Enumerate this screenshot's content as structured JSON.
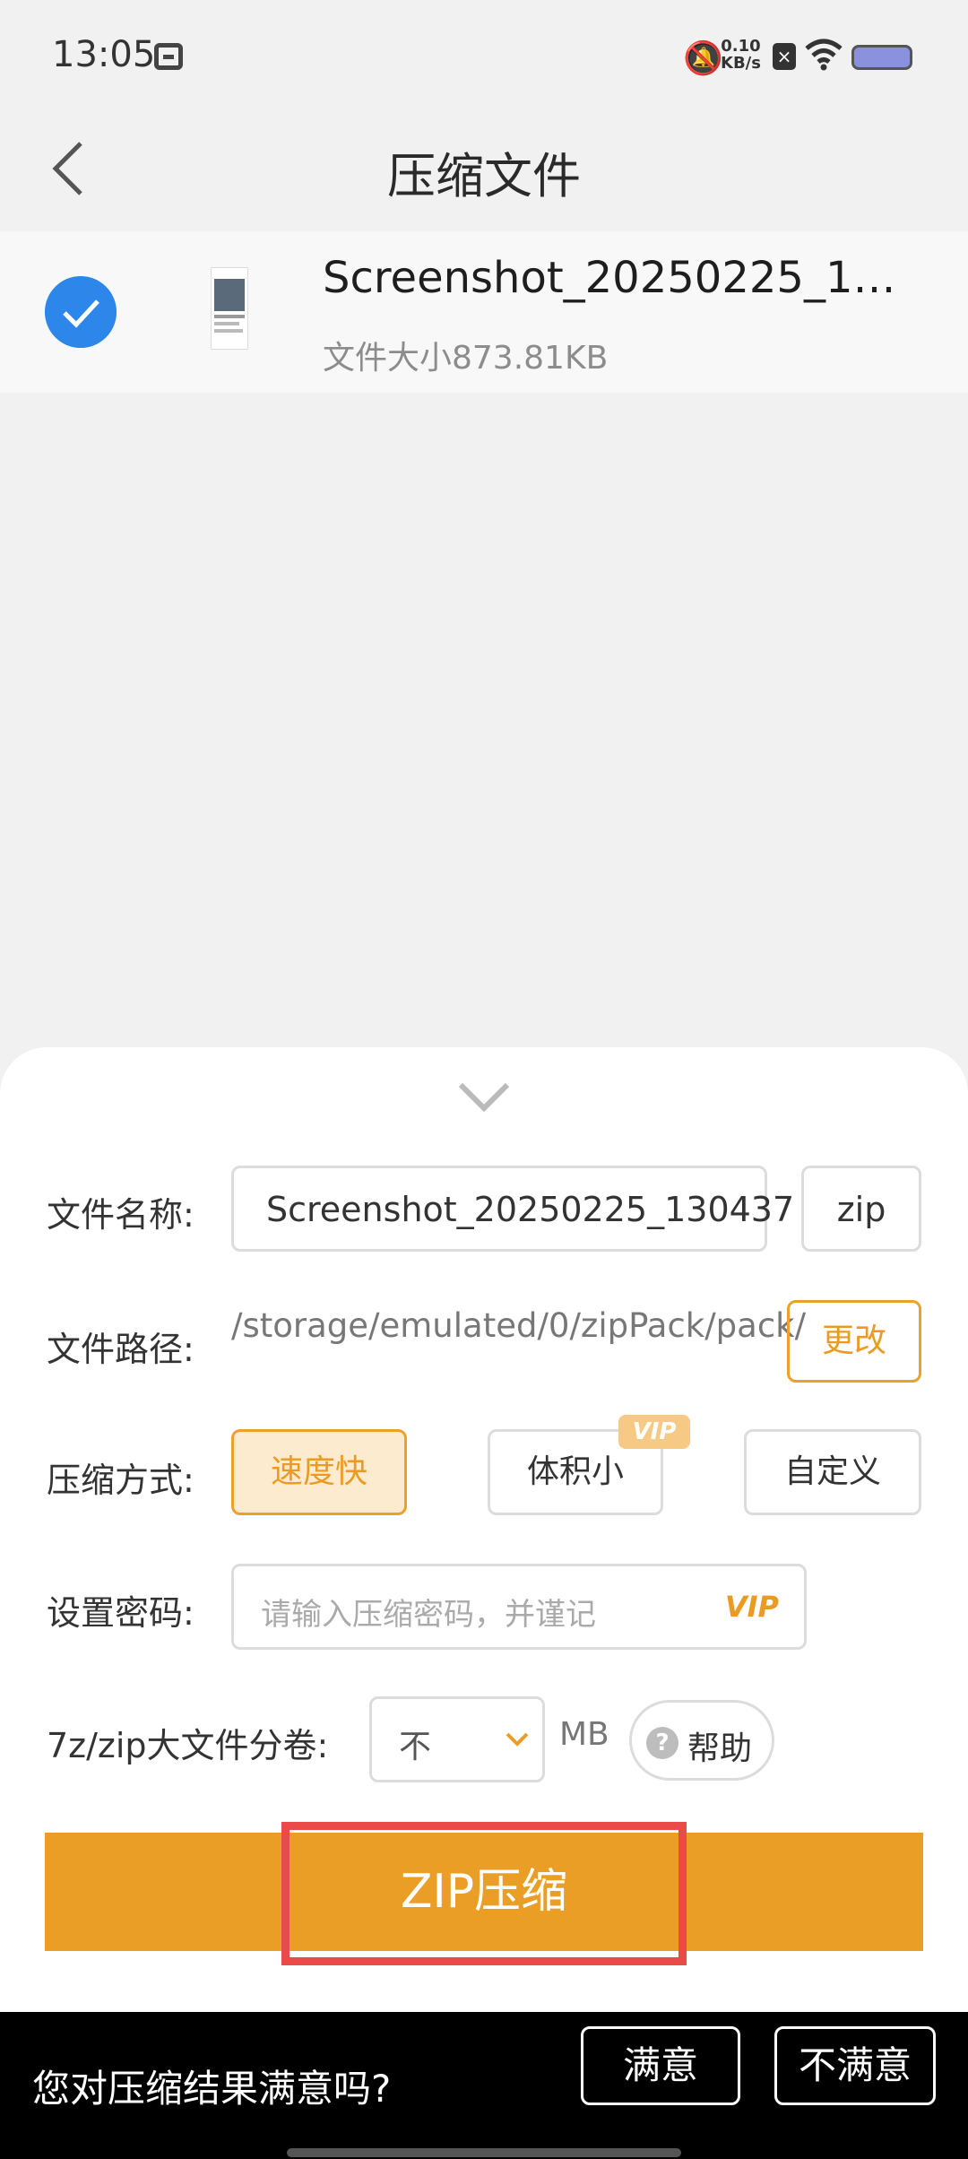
{
  "status": {
    "time": "13:05",
    "speed_value": "0.10",
    "speed_unit": "KB/s",
    "battery_color": "#8a92dd"
  },
  "header": {
    "title": "压缩文件"
  },
  "file": {
    "name": "Screenshot_20250225_1…",
    "size": "文件大小873.81KB"
  },
  "form": {
    "name_label": "文件名称:",
    "name_value": "Screenshot_20250225_130437",
    "extension": "zip",
    "path_label": "文件路径:",
    "path_value": "/storage/emulated/0/zipPack/pack/",
    "change_label": "更改",
    "mode_label": "压缩方式:",
    "modes": [
      "速度快",
      "体积小",
      "自定义"
    ],
    "mode_vip": "VIP",
    "password_label": "设置密码:",
    "password_placeholder": "请输入压缩密码，并谨记",
    "password_vip": "VIP",
    "split_label": "7z/zip大文件分卷:",
    "split_value": "不",
    "split_unit": "MB",
    "help_label": "帮助",
    "help_glyph": "?",
    "compress_button": "ZIP压缩"
  },
  "feedback": {
    "question": "您对压缩结果满意吗?",
    "satisfied": "满意",
    "unsatisfied": "不满意"
  },
  "colors": {
    "accent_orange": "#eb9e25",
    "check_blue": "#2d86ea",
    "highlight_red": "#ea4b49"
  }
}
